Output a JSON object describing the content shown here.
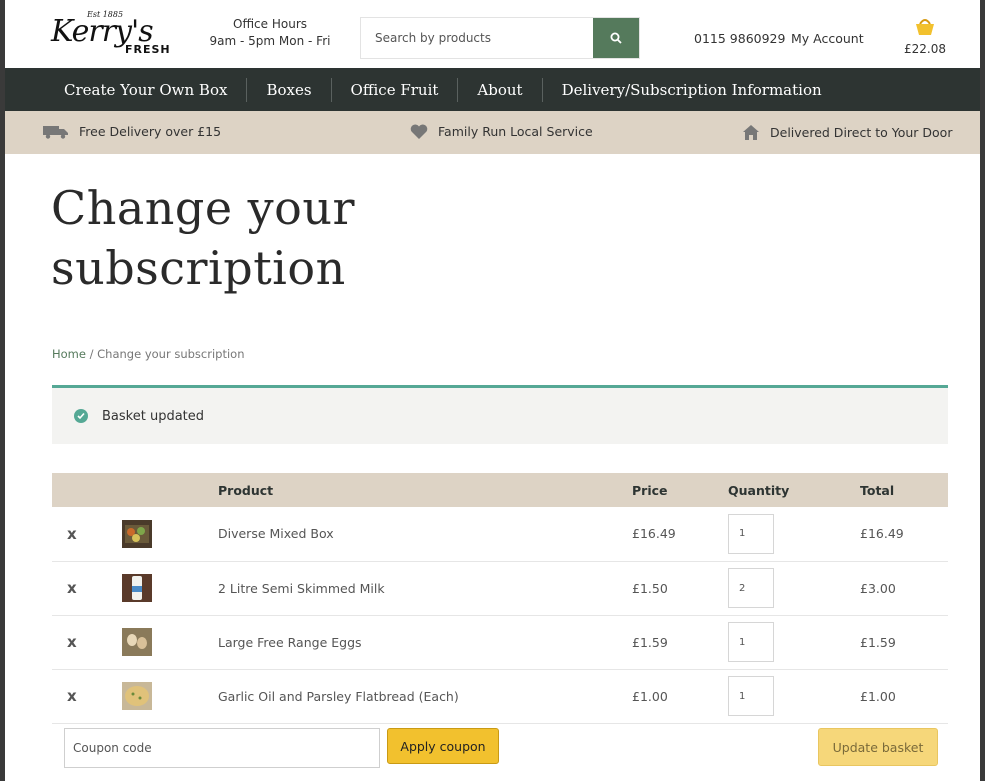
{
  "header": {
    "logo_est": "Est 1885",
    "logo_script": "Kerry's",
    "logo_fresh": "FRESH",
    "hours_title": "Office Hours",
    "hours_text": "9am - 5pm Mon - Fri",
    "search_placeholder": "Search by products",
    "phone": "0115 9860929",
    "account": "My Account",
    "basket_total": "£22.08"
  },
  "nav": {
    "items": [
      "Create Your Own Box",
      "Boxes",
      "Office Fruit",
      "About",
      "Delivery/Subscription Information"
    ]
  },
  "benefits": {
    "delivery": "Free Delivery over £15",
    "family": "Family Run Local Service",
    "door": "Delivered Direct to Your Door"
  },
  "page": {
    "title_line1": "Change your",
    "title_line2": "subscription",
    "breadcrumb_home": "Home",
    "breadcrumb_sep": "/",
    "breadcrumb_current": "Change your subscription",
    "notice": "Basket updated"
  },
  "table": {
    "headers": {
      "product": "Product",
      "price": "Price",
      "quantity": "Quantity",
      "total": "Total"
    },
    "rows": [
      {
        "remove": "x",
        "name": "Diverse Mixed Box",
        "price": "£16.49",
        "qty": "1",
        "total": "£16.49"
      },
      {
        "remove": "x",
        "name": "2 Litre Semi Skimmed Milk",
        "price": "£1.50",
        "qty": "2",
        "total": "£3.00"
      },
      {
        "remove": "x",
        "name": "Large Free Range Eggs",
        "price": "£1.59",
        "qty": "1",
        "total": "£1.59"
      },
      {
        "remove": "x",
        "name": "Garlic Oil and Parsley Flatbread (Each)",
        "price": "£1.00",
        "qty": "1",
        "total": "£1.00"
      }
    ]
  },
  "actions": {
    "coupon_placeholder": "Coupon code",
    "apply_label": "Apply coupon",
    "update_label": "Update basket"
  },
  "colors": {
    "brand_green": "#557a5c",
    "nav_bg": "#2d3432",
    "beige": "#ddd3c5",
    "notice_accent": "#55a895",
    "remove_red": "#e02020",
    "button_yellow": "#f2c12e"
  }
}
